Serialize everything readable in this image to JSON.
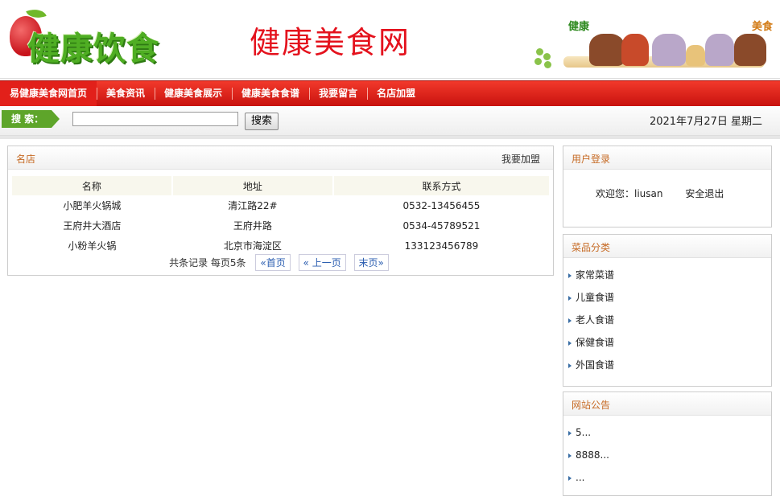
{
  "header": {
    "logo_text": "健康饮食",
    "site_title": "健康美食网",
    "banner_left_tag": "健康",
    "banner_right_tag": "美食"
  },
  "nav": {
    "items": [
      {
        "label": "易健康美食网首页"
      },
      {
        "label": "美食资讯"
      },
      {
        "label": "健康美食展示"
      },
      {
        "label": "健康美食食谱"
      },
      {
        "label": "我要留言"
      },
      {
        "label": "名店加盟"
      }
    ]
  },
  "search": {
    "label": "搜 索：",
    "value": "",
    "button": "搜索"
  },
  "date": "2021年7月27日 星期二",
  "shops": {
    "title": "名店",
    "join_link": "我要加盟",
    "columns": [
      "名称",
      "地址",
      "联系方式"
    ],
    "rows": [
      [
        "小肥羊火锅城",
        "清江路22#",
        "0532-13456455"
      ],
      [
        "王府井大酒店",
        "王府井路",
        "0534-45789521"
      ],
      [
        "小粉羊火锅",
        "北京市海淀区",
        "133123456789"
      ]
    ],
    "pager": {
      "summary": "共条记录 每页5条",
      "first": "«首页",
      "prev": "« 上一页",
      "last": "末页»"
    }
  },
  "login": {
    "title": "用户登录",
    "welcome": "欢迎您：liusan",
    "logout": "安全退出"
  },
  "categories": {
    "title": "菜品分类",
    "items": [
      "家常菜谱",
      "儿童食谱",
      "老人食谱",
      "保健食谱",
      "外国食谱"
    ]
  },
  "notices": {
    "title": "网站公告",
    "items": [
      "5...",
      "8888...",
      "..."
    ]
  },
  "colors": {
    "nav_red": "#d41e17",
    "search_green": "#5ea52a",
    "panel_title_orange": "#c66a24",
    "title_red": "#e4121d"
  }
}
